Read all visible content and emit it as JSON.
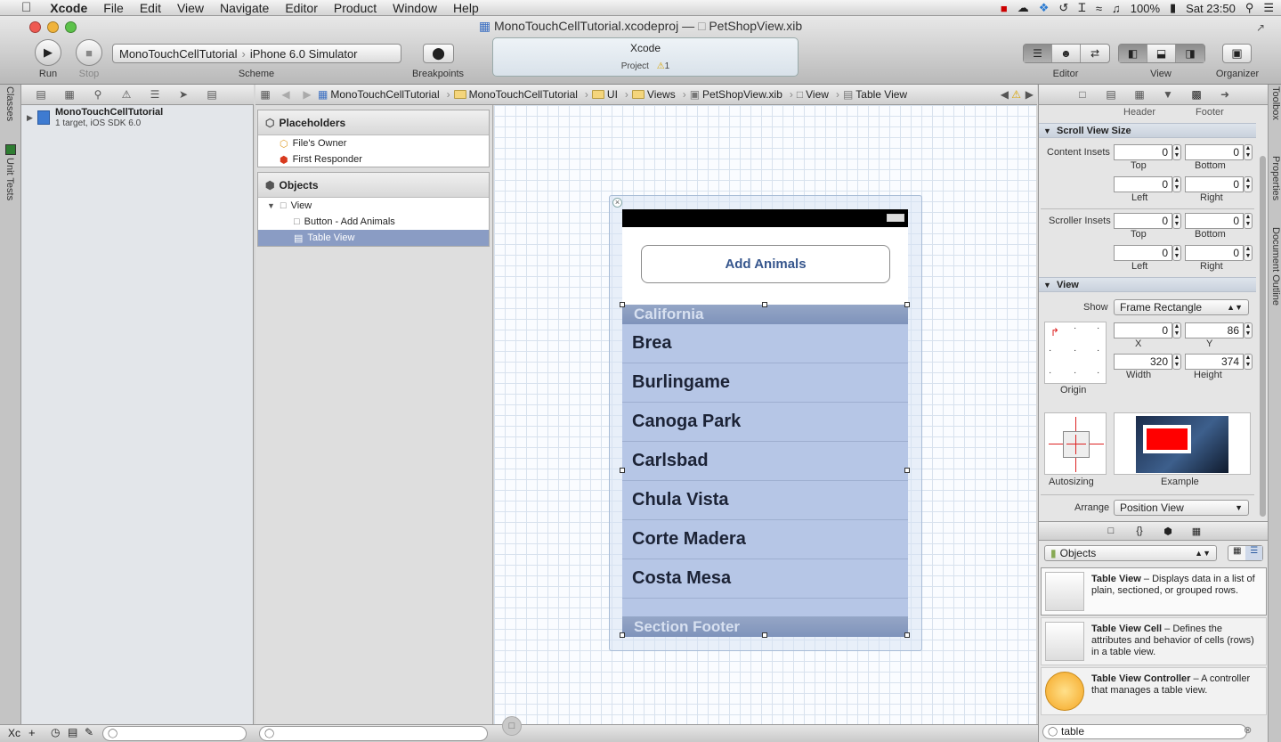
{
  "menubar": {
    "app_name": "Xcode",
    "items": [
      "File",
      "Edit",
      "View",
      "Navigate",
      "Editor",
      "Product",
      "Window",
      "Help"
    ],
    "battery": "100%",
    "clock": "Sat 23:50"
  },
  "window": {
    "project_file": "MonoTouchCellTutorial.xcodeproj",
    "separator": "—",
    "open_file": "PetShopView.xib"
  },
  "toolbar": {
    "run_label": "Run",
    "stop_label": "Stop",
    "scheme_target": "MonoTouchCellTutorial",
    "scheme_device": "iPhone 6.0 Simulator",
    "scheme_label": "Scheme",
    "breakpoints_label": "Breakpoints",
    "activity_title": "Xcode",
    "activity_project": "Project",
    "activity_warnings": "1",
    "editor_label": "Editor",
    "view_label": "View",
    "organizer_label": "Organizer"
  },
  "side_tabs": {
    "classes": "Classes",
    "unit_tests": "Unit Tests",
    "toolbox": "Toolbox",
    "properties": "Properties",
    "document_outline": "Document Outline"
  },
  "navigator": {
    "project_name": "MonoTouchCellTutorial",
    "project_subtitle": "1 target, iOS SDK 6.0"
  },
  "breadcrumb": [
    "MonoTouchCellTutorial",
    "MonoTouchCellTutorial",
    "UI",
    "Views",
    "PetShopView.xib",
    "View",
    "Table View"
  ],
  "outline": {
    "placeholders_title": "Placeholders",
    "files_owner": "File's Owner",
    "first_responder": "First Responder",
    "objects_title": "Objects",
    "view": "View",
    "button": "Button - Add Animals",
    "table_view": "Table View"
  },
  "phone": {
    "button_label": "Add Animals",
    "section_header": "California",
    "rows": [
      "Brea",
      "Burlingame",
      "Canoga Park",
      "Carlsbad",
      "Chula Vista",
      "Corte Madera",
      "Costa Mesa"
    ],
    "section_footer": "Section Footer"
  },
  "inspector": {
    "header_label": "Header",
    "footer_label": "Footer",
    "scroll_view_size_title": "Scroll View Size",
    "content_insets_label": "Content Insets",
    "scroller_insets_label": "Scroller Insets",
    "content_insets": {
      "top": "0",
      "bottom": "0",
      "left": "0",
      "right": "0"
    },
    "scroller_insets": {
      "top": "0",
      "bottom": "0",
      "left": "0",
      "right": "0"
    },
    "top_label": "Top",
    "bottom_label": "Bottom",
    "left_label": "Left",
    "right_label": "Right",
    "view_title": "View",
    "show_label": "Show",
    "show_value": "Frame Rectangle",
    "x_value": "0",
    "y_value": "86",
    "width_value": "320",
    "height_value": "374",
    "x_label": "X",
    "y_label": "Y",
    "width_label": "Width",
    "height_label": "Height",
    "origin_label": "Origin",
    "autosizing_label": "Autosizing",
    "example_label": "Example",
    "arrange_label": "Arrange",
    "arrange_value": "Position View"
  },
  "library": {
    "filter_value": "Objects",
    "items": [
      {
        "title": "Table View",
        "desc": "Displays data in a list of plain, sectioned, or grouped rows."
      },
      {
        "title": "Table View Cell",
        "desc": "Defines the attributes and behavior of cells (rows) in a table view."
      },
      {
        "title": "Table View Controller",
        "desc": "A controller that manages a table view."
      }
    ],
    "search_value": "table"
  },
  "bottom": {
    "left_stub": "Xc"
  },
  "colors": {
    "table_bg": "#b6c6e6",
    "selection": "#8a9cc4",
    "section_header": "#7f93bb",
    "example_red": "#ff0000"
  }
}
